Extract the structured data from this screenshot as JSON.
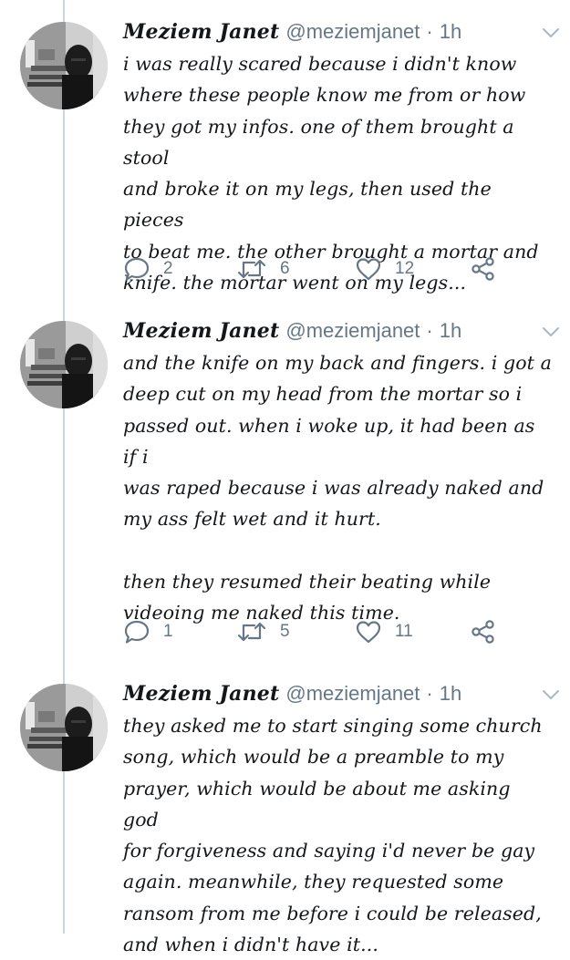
{
  "tweets": [
    {
      "author_name": "Meziem Janet",
      "handle": "@meziemjanet",
      "separator": "·",
      "time": "1h",
      "lines": [
        "i was really scared because i didn't know",
        "where these people know me from or how",
        "they got my infos. one of them brought a stool",
        "and broke it on my legs, then used the pieces",
        "to beat me. the other brought a mortar and",
        "knife. the mortar went on my legs..."
      ],
      "replies": "2",
      "retweets": "6",
      "likes": "12"
    },
    {
      "author_name": "Meziem Janet",
      "handle": "@meziemjanet",
      "separator": "·",
      "time": "1h",
      "lines": [
        "and the knife on my back and fingers. i got a",
        "deep cut on my head from the mortar so i",
        "passed out. when i woke up, it had been as if i",
        "was raped because i was already naked and",
        "my ass felt wet and it hurt."
      ],
      "lines2": [
        "then they resumed their beating while",
        "videoing me naked this time."
      ],
      "replies": "1",
      "retweets": "5",
      "likes": "11"
    },
    {
      "author_name": "Meziem Janet",
      "handle": "@meziemjanet",
      "separator": "·",
      "time": "1h",
      "lines": [
        "they asked me to start singing some church",
        "song, which would be a preamble to my",
        "prayer, which would be about me asking god",
        "for forgiveness and saying i'd never be gay",
        "again. meanwhile, they requested some",
        "ransom from me before i could be released,",
        "and when i didn't have it..."
      ]
    }
  ],
  "icons": {
    "reply": "reply-icon",
    "retweet": "retweet-icon",
    "like": "heart-icon",
    "share": "share-icon",
    "menu": "chevron-down-icon"
  },
  "colors": {
    "text": "#14171a",
    "muted": "#657786",
    "thread_line": "#ccd6dd"
  }
}
